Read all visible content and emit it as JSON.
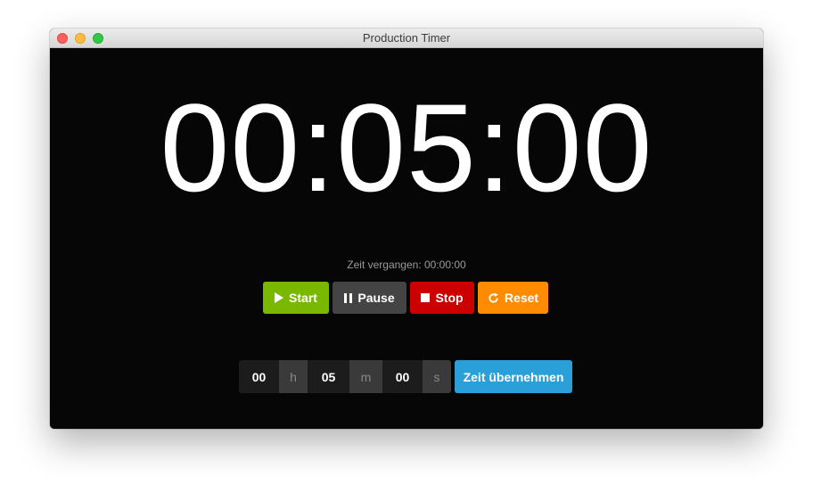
{
  "window": {
    "title": "Production Timer"
  },
  "timer": {
    "display": "00:05:00",
    "elapsed": "Zeit vergangen: 00:00:00"
  },
  "controls": {
    "start_label": "Start",
    "start_icon": "play-icon",
    "pause_label": "Pause",
    "pause_icon": "pause-icon",
    "stop_label": "Stop",
    "stop_icon": "stop-icon",
    "reset_label": "Reset",
    "reset_icon": "refresh-icon"
  },
  "time_input": {
    "hours": "00",
    "hours_unit": "h",
    "minutes": "05",
    "minutes_unit": "m",
    "seconds": "00",
    "seconds_unit": "s",
    "apply_label": "Zeit übernehmen"
  },
  "colors": {
    "background": "#060606",
    "start": "#7ab800",
    "pause": "#444444",
    "stop": "#cc0000",
    "reset": "#ff8c00",
    "apply": "#2a9fd8"
  }
}
